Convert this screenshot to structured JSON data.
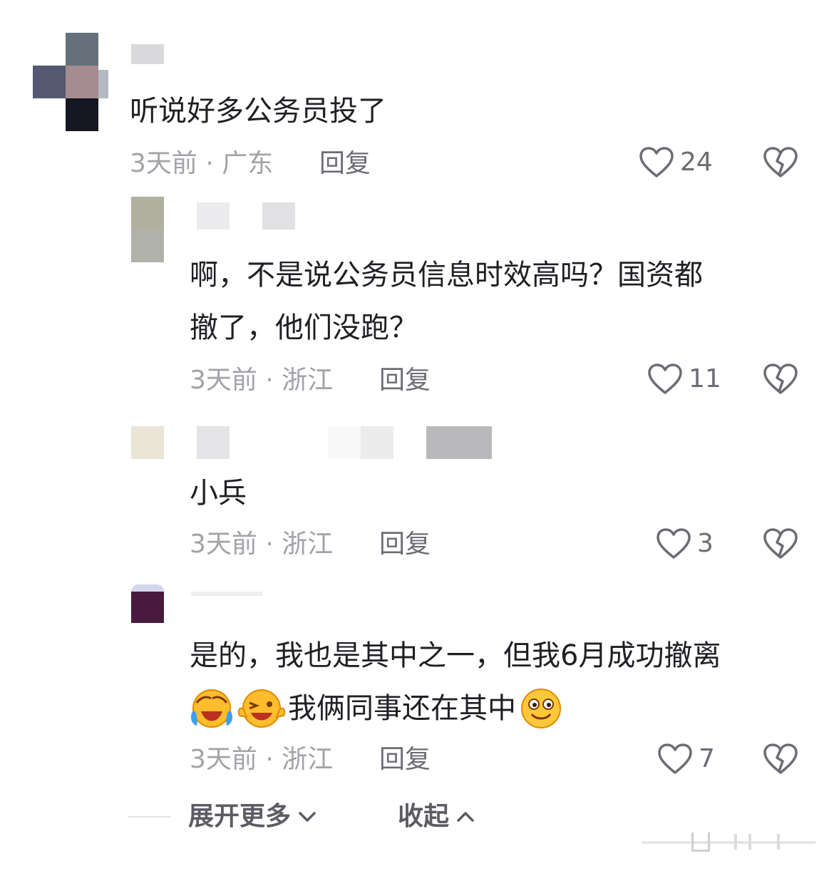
{
  "comments": [
    {
      "text": "听说好多公务员投了",
      "time": "3天前",
      "location": "广东",
      "reply": "回复",
      "likes": "24"
    },
    {
      "text_line1": "啊，不是说公务员信息时效高吗？国资都",
      "text_line2": "撤了，他们没跑？",
      "time": "3天前",
      "location": "浙江",
      "reply": "回复",
      "likes": "11"
    },
    {
      "text": "小兵",
      "time": "3天前",
      "location": "浙江",
      "reply": "回复",
      "likes": "3"
    },
    {
      "text_line1": "是的，我也是其中之一，但我6月成功撤离",
      "text_line2": "我俩同事还在其中",
      "time": "3天前",
      "location": "浙江",
      "reply": "回复",
      "likes": "7"
    }
  ],
  "footer": {
    "expand": "展开更多",
    "collapse": "收起"
  },
  "colors": {
    "meta": "#a2a2a8",
    "action": "#6c6c74",
    "text": "#1f1f24"
  }
}
